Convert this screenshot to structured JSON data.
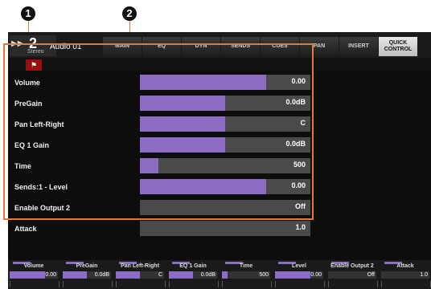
{
  "callouts": [
    "1",
    "2"
  ],
  "header": {
    "channel_number": "2",
    "channel_type": "Stereo",
    "channel_name": "Audio 01",
    "tabs": [
      {
        "label": "MAIN"
      },
      {
        "label": "EQ"
      },
      {
        "label": "DYN"
      },
      {
        "label": "SENDS"
      },
      {
        "label": "CUES"
      },
      {
        "label": "PAN"
      },
      {
        "label": "INSERT"
      },
      {
        "label": "QUICK CONTROL"
      }
    ]
  },
  "params": [
    {
      "label": "Volume",
      "value": "0.00",
      "fill": 0.74
    },
    {
      "label": "PreGain",
      "value": "0.0dB",
      "fill": 0.5
    },
    {
      "label": "Pan Left-Right",
      "value": "C",
      "fill": 0.5
    },
    {
      "label": "EQ 1 Gain",
      "value": "0.0dB",
      "fill": 0.5
    },
    {
      "label": "Time",
      "value": "500",
      "fill": 0.11
    },
    {
      "label": "Sends:1 - Level",
      "value": "0.00",
      "fill": 0.74
    },
    {
      "label": "Enable Output 2",
      "value": "Off",
      "fill": 0.0
    },
    {
      "label": "Attack",
      "value": "1.0",
      "fill": 0.0
    }
  ],
  "bottom": [
    {
      "label": "Volume",
      "value": "0.00",
      "fill": 0.74
    },
    {
      "label": "PreGain",
      "value": "0.0dB",
      "fill": 0.5
    },
    {
      "label": "Pan Left-Right",
      "value": "C",
      "fill": 0.5
    },
    {
      "label": "EQ 1 Gain",
      "value": "0.0dB",
      "fill": 0.5
    },
    {
      "label": "Time",
      "value": "500",
      "fill": 0.11
    },
    {
      "label": "Level",
      "value": "0.00",
      "fill": 0.74
    },
    {
      "label": "Enable Output 2",
      "value": "Off",
      "fill": 0.0
    },
    {
      "label": "Attack",
      "value": "1.0",
      "fill": 0.0
    }
  ],
  "colors": {
    "accent": "#8c6cc4",
    "callout_line": "#e07b39",
    "flag": "#9a0e0e"
  }
}
